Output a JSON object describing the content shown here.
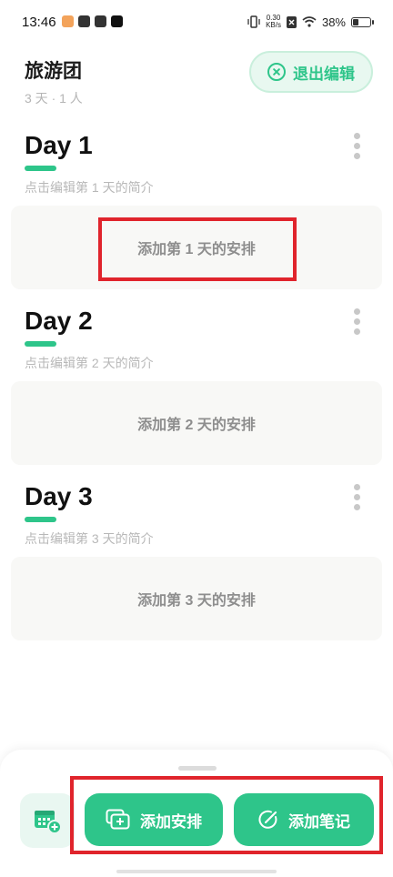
{
  "status_bar": {
    "time": "13:46",
    "speed_value": "0.30",
    "speed_unit": "KB/s",
    "battery_percent": "38%",
    "battery_level": 0.38
  },
  "header": {
    "title": "旅游团",
    "meta": "3 天 · 1 人",
    "exit_edit_label": "退出编辑"
  },
  "days": [
    {
      "title": "Day 1",
      "description": "点击编辑第 1 天的简介",
      "add_plan_label": "添加第 1 天的安排"
    },
    {
      "title": "Day 2",
      "description": "点击编辑第 2 天的简介",
      "add_plan_label": "添加第 2 天的安排"
    },
    {
      "title": "Day 3",
      "description": "点击编辑第 3 天的简介",
      "add_plan_label": "添加第 3 天的安排"
    }
  ],
  "bottom_bar": {
    "add_plan_label": "添加安排",
    "add_note_label": "添加笔记"
  },
  "colors": {
    "accent": "#2ec58a",
    "highlight": "#e0242c"
  }
}
